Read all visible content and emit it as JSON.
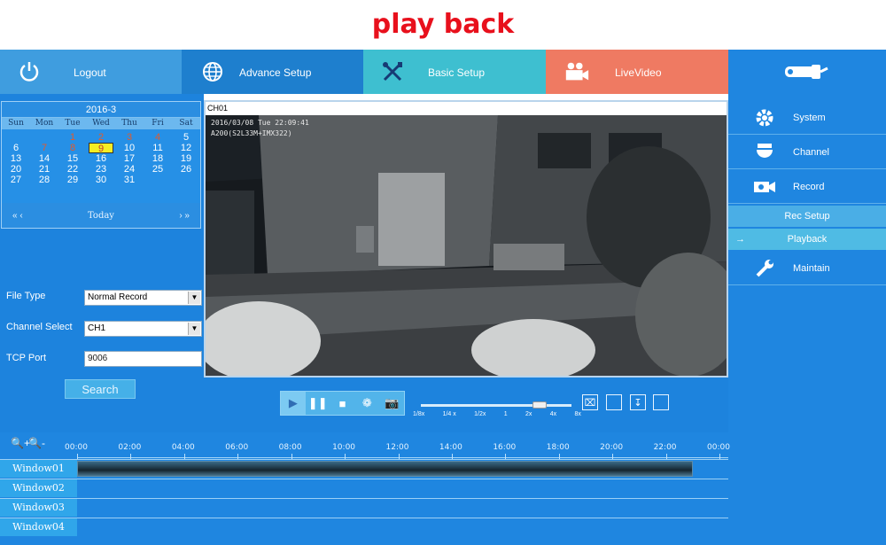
{
  "banner": {
    "title": "play back"
  },
  "topnav": {
    "logout": "Logout",
    "advance_setup": "Advance Setup",
    "basic_setup": "Basic Setup",
    "live_video": "LiveVideo"
  },
  "calendar": {
    "month": "2016-3",
    "weekdays": [
      "Sun",
      "Mon",
      "Tue",
      "Wed",
      "Thu",
      "Fri",
      "Sat"
    ],
    "days": [
      "",
      "",
      "1",
      "2",
      "3",
      "4",
      "5",
      "6",
      "7",
      "8",
      "9",
      "10",
      "11",
      "12",
      "13",
      "14",
      "15",
      "16",
      "17",
      "18",
      "19",
      "20",
      "21",
      "22",
      "23",
      "24",
      "25",
      "26",
      "27",
      "28",
      "29",
      "30",
      "31",
      "",
      ""
    ],
    "record_days": [
      "1",
      "2",
      "3",
      "4",
      "7",
      "8"
    ],
    "selected_day": "9",
    "prev_nav": "« ‹",
    "today": "Today",
    "next_nav": "› »"
  },
  "search_form": {
    "file_type_label": "File Type",
    "file_type_value": "Normal Record",
    "channel_label": "Channel Select",
    "channel_value": "CH1",
    "tcp_port_label": "TCP Port",
    "tcp_port_value": "9006",
    "search_button": "Search"
  },
  "video": {
    "channel_title": "CH01",
    "osd_time": "2016/03/08 Tue 22:09:41",
    "osd_model": "A200(S2L33M+IMX322)"
  },
  "playback_controls": {
    "speed_labels": [
      "1/8x",
      "1/4 x",
      "1/2x",
      "1",
      "2x",
      "4x",
      "8x"
    ],
    "speed_level": "4x"
  },
  "right_menu": {
    "system": "System",
    "channel": "Channel",
    "record": "Record",
    "rec_setup": "Rec Setup",
    "playback_arrow": "→",
    "playback": "Playback",
    "maintain": "Maintain"
  },
  "timeline": {
    "hours": [
      "00:00",
      "02:00",
      "04:00",
      "06:00",
      "08:00",
      "10:00",
      "12:00",
      "14:00",
      "16:00",
      "18:00",
      "20:00",
      "22:00",
      "00:00"
    ],
    "windows": [
      "Window01",
      "Window02",
      "Window03",
      "Window04"
    ],
    "recording": {
      "window": "Window01",
      "start": "00:00",
      "end": "23:00"
    }
  },
  "colors": {
    "banner_text": "#e8101c",
    "panel_blue": "#1f86e0",
    "logout_tab": "#3f9ddf",
    "advance_tab": "#1e7fce",
    "basic_tab": "#3ebfd0",
    "live_tab": "#ef7a62",
    "selected_day": "#f5ee23"
  }
}
